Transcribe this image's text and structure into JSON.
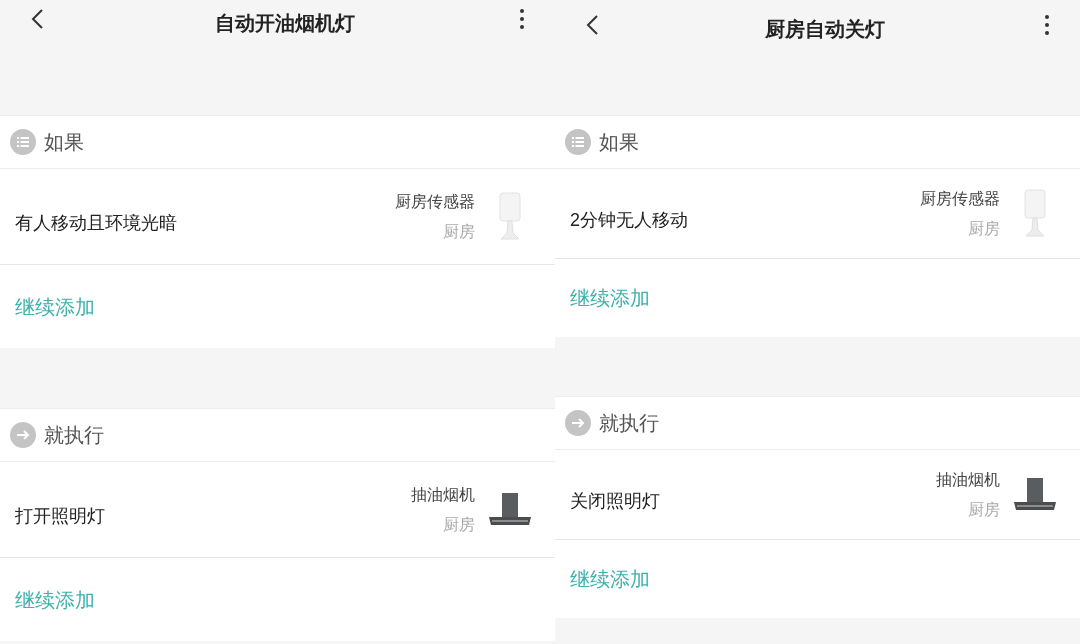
{
  "screens": [
    {
      "title": "自动开油烟机灯",
      "sections": [
        {
          "kind": "condition",
          "heading": "如果",
          "item": {
            "label": "有人移动且环境光暗",
            "device": "厨房传感器",
            "room": "厨房",
            "kind": "sensor"
          },
          "add_label": "继续添加"
        },
        {
          "kind": "action",
          "heading": "就执行",
          "item": {
            "label": "打开照明灯",
            "device": "抽油烟机",
            "room": "厨房",
            "kind": "hood"
          },
          "add_label": "继续添加"
        }
      ]
    },
    {
      "title": "厨房自动关灯",
      "sections": [
        {
          "kind": "condition",
          "heading": "如果",
          "item": {
            "label": "2分钟无人移动",
            "device": "厨房传感器",
            "room": "厨房",
            "kind": "sensor"
          },
          "add_label": "继续添加"
        },
        {
          "kind": "action",
          "heading": "就执行",
          "item": {
            "label": "关闭照明灯",
            "device": "抽油烟机",
            "room": "厨房",
            "kind": "hood"
          },
          "add_label": "继续添加"
        }
      ]
    }
  ]
}
